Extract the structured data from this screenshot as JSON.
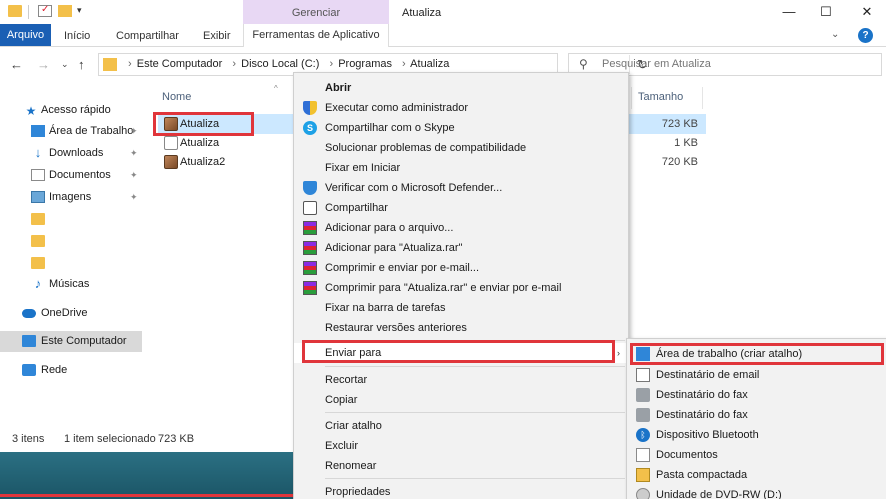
{
  "titlebar": {
    "manage_tab": "Gerenciar",
    "window_title": "Atualiza",
    "minimize": "—",
    "maximize": "☐",
    "close": "✕"
  },
  "ribbon": {
    "tabs": [
      "Arquivo",
      "Início",
      "Compartilhar",
      "Exibir",
      "Ferramentas de Aplicativo"
    ],
    "expand_glyph": "⌄",
    "help_glyph": "?"
  },
  "address": {
    "crumbs": [
      "Este Computador",
      "Disco Local (C:)",
      "Programas",
      "Atualiza"
    ],
    "separator": "›",
    "search_placeholder": "Pesquisar em Atualiza"
  },
  "nav": {
    "items": [
      {
        "label": "Acesso rápido",
        "icon": "star-icon",
        "pinned": false
      },
      {
        "label": "Área de Trabalho",
        "icon": "desktop-icon",
        "pinned": true
      },
      {
        "label": "Downloads",
        "icon": "download-icon",
        "pinned": true
      },
      {
        "label": "Documentos",
        "icon": "document-icon",
        "pinned": true
      },
      {
        "label": "Imagens",
        "icon": "image-icon",
        "pinned": true
      },
      {
        "label": "",
        "icon": "folder-icon",
        "pinned": false
      },
      {
        "label": "",
        "icon": "folder-icon",
        "pinned": false
      },
      {
        "label": "",
        "icon": "folder-icon",
        "pinned": false
      },
      {
        "label": "Músicas",
        "icon": "music-icon",
        "pinned": false
      },
      {
        "label": "OneDrive",
        "icon": "cloud-icon",
        "pinned": false
      },
      {
        "label": "Este Computador",
        "icon": "computer-icon",
        "pinned": false
      },
      {
        "label": "Rede",
        "icon": "network-icon",
        "pinned": false
      }
    ],
    "pin_glyph": "📌"
  },
  "files": {
    "col_name": "Nome",
    "col_size": "Tamanho",
    "sort_glyph": "^",
    "rows": [
      {
        "name": "Atualiza",
        "size": "723 KB",
        "selected": true
      },
      {
        "name": "Atualiza",
        "size": "1 KB",
        "selected": false
      },
      {
        "name": "Atualiza2",
        "size": "720 KB",
        "selected": false
      }
    ]
  },
  "status": {
    "count": "3 itens",
    "selection": "1 item selecionado",
    "size": "723 KB"
  },
  "context_menu": {
    "items": [
      {
        "label": "Abrir",
        "icon": ""
      },
      {
        "label": "Executar como administrador",
        "icon": "shield-icon"
      },
      {
        "label": "Compartilhar com o Skype",
        "icon": "skype-icon"
      },
      {
        "label": "Solucionar problemas de compatibilidade",
        "icon": ""
      },
      {
        "label": "Fixar em Iniciar",
        "icon": ""
      },
      {
        "label": "Verificar com o Microsoft Defender...",
        "icon": "defender-icon"
      },
      {
        "label": "Compartilhar",
        "icon": "share-icon"
      },
      {
        "label": "Adicionar para o arquivo...",
        "icon": "winrar-icon"
      },
      {
        "label": "Adicionar para \"Atualiza.rar\"",
        "icon": "winrar-icon"
      },
      {
        "label": "Comprimir e enviar por e-mail...",
        "icon": "winrar-icon"
      },
      {
        "label": "Comprimir para \"Atualiza.rar\" e enviar por e-mail",
        "icon": "winrar-icon"
      },
      {
        "label": "Fixar na barra de tarefas",
        "icon": ""
      },
      {
        "label": "Restaurar versões anteriores",
        "icon": ""
      },
      {
        "label": "Enviar para",
        "icon": ""
      },
      {
        "label": "Recortar",
        "icon": ""
      },
      {
        "label": "Copiar",
        "icon": ""
      },
      {
        "label": "Criar atalho",
        "icon": ""
      },
      {
        "label": "Excluir",
        "icon": ""
      },
      {
        "label": "Renomear",
        "icon": ""
      },
      {
        "label": "Propriedades",
        "icon": ""
      }
    ],
    "submenu_arrow": "›"
  },
  "send_to_menu": {
    "items": [
      {
        "label": "Área de trabalho (criar atalho)",
        "icon": "desktop-icon"
      },
      {
        "label": "Destinatário de email",
        "icon": "mail-icon"
      },
      {
        "label": "Destinatário do fax",
        "icon": "fax-icon"
      },
      {
        "label": "Destinatário do fax",
        "icon": "fax-icon"
      },
      {
        "label": "Dispositivo Bluetooth",
        "icon": "bluetooth-icon"
      },
      {
        "label": "Documentos",
        "icon": "document-icon"
      },
      {
        "label": "Pasta compactada",
        "icon": "zip-folder-icon"
      },
      {
        "label": "Unidade de DVD-RW (D:)",
        "icon": "dvd-icon"
      }
    ]
  },
  "colors": {
    "accent": "#1a5fb4",
    "manage_tab_bg": "#e8d8f4",
    "selection": "#cce8ff",
    "highlight_border": "#e0353b",
    "taskbar": "#2b7083"
  }
}
